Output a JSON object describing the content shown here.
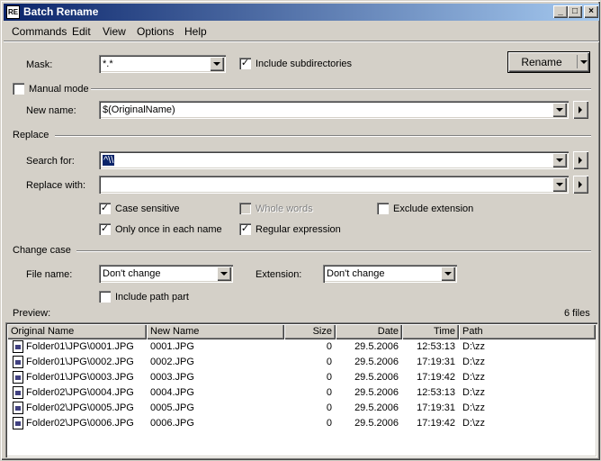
{
  "window": {
    "title": "Batch Rename",
    "icon": "app-icon"
  },
  "titlebar_buttons": {
    "minimize": "_",
    "maximize": "□",
    "close": "×"
  },
  "menu": [
    "Commands",
    "Edit",
    "View",
    "Options",
    "Help"
  ],
  "mask": {
    "label": "Mask:",
    "value": "*.*"
  },
  "include_subdirectories": {
    "label": "Include subdirectories",
    "checked": true
  },
  "rename_button": {
    "label": "Rename"
  },
  "manual_mode": {
    "label": "Manual mode",
    "checked": false
  },
  "new_name": {
    "label": "New name:",
    "value": "$(OriginalName)"
  },
  "replace_section": {
    "label": "Replace"
  },
  "search_for": {
    "label": "Search for:",
    "value": "^\\\\"
  },
  "replace_with": {
    "label": "Replace with:",
    "value": ""
  },
  "options": {
    "case_sensitive": {
      "label": "Case sensitive",
      "checked": true
    },
    "whole_words": {
      "label": "Whole words",
      "checked": false,
      "disabled": true
    },
    "exclude_extension": {
      "label": "Exclude extension",
      "checked": false
    },
    "only_once": {
      "label": "Only once in each name",
      "checked": true
    },
    "regular_expression": {
      "label": "Regular expression",
      "checked": true
    }
  },
  "change_case": {
    "label": "Change case",
    "file_name": {
      "label": "File name:",
      "value": "Don't change"
    },
    "extension": {
      "label": "Extension:",
      "value": "Don't change"
    },
    "include_path_part": {
      "label": "Include path part",
      "checked": false
    }
  },
  "preview": {
    "label": "Preview:",
    "count": "6 files",
    "columns": [
      "Original Name",
      "New Name",
      "Size",
      "Date",
      "Time",
      "Path"
    ],
    "rows": [
      {
        "original": "Folder01\\JPG\\0001.JPG",
        "new": "0001.JPG",
        "size": "0",
        "date": "29.5.2006",
        "time": "12:53:13",
        "path": "D:\\zz"
      },
      {
        "original": "Folder01\\JPG\\0002.JPG",
        "new": "0002.JPG",
        "size": "0",
        "date": "29.5.2006",
        "time": "17:19:31",
        "path": "D:\\zz"
      },
      {
        "original": "Folder01\\JPG\\0003.JPG",
        "new": "0003.JPG",
        "size": "0",
        "date": "29.5.2006",
        "time": "17:19:42",
        "path": "D:\\zz"
      },
      {
        "original": "Folder02\\JPG\\0004.JPG",
        "new": "0004.JPG",
        "size": "0",
        "date": "29.5.2006",
        "time": "12:53:13",
        "path": "D:\\zz"
      },
      {
        "original": "Folder02\\JPG\\0005.JPG",
        "new": "0005.JPG",
        "size": "0",
        "date": "29.5.2006",
        "time": "17:19:31",
        "path": "D:\\zz"
      },
      {
        "original": "Folder02\\JPG\\0006.JPG",
        "new": "0006.JPG",
        "size": "0",
        "date": "29.5.2006",
        "time": "17:19:42",
        "path": "D:\\zz"
      }
    ]
  }
}
